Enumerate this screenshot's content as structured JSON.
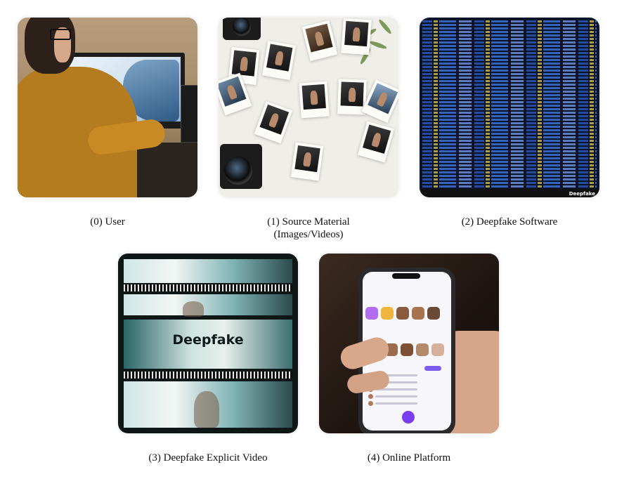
{
  "panels": [
    {
      "index": "0",
      "caption": "(0) User"
    },
    {
      "index": "1",
      "caption_line1": "(1) Source Material",
      "caption_line2": "(Images/Videos)"
    },
    {
      "index": "2",
      "caption": "(2) Deepfake Software",
      "image_brand_text": "Deepfake"
    },
    {
      "index": "3",
      "caption": "(3) Deepfake Explicit Video",
      "image_overlay_text": "Deepfake"
    },
    {
      "index": "4",
      "caption": "(4) Online Platform"
    }
  ],
  "colors": {
    "background": "#ffffff",
    "caption_text": "#111111"
  },
  "icons": [
    "user-photo",
    "polaroid-photos",
    "code-screen",
    "film-strip",
    "smartphone-app"
  ]
}
